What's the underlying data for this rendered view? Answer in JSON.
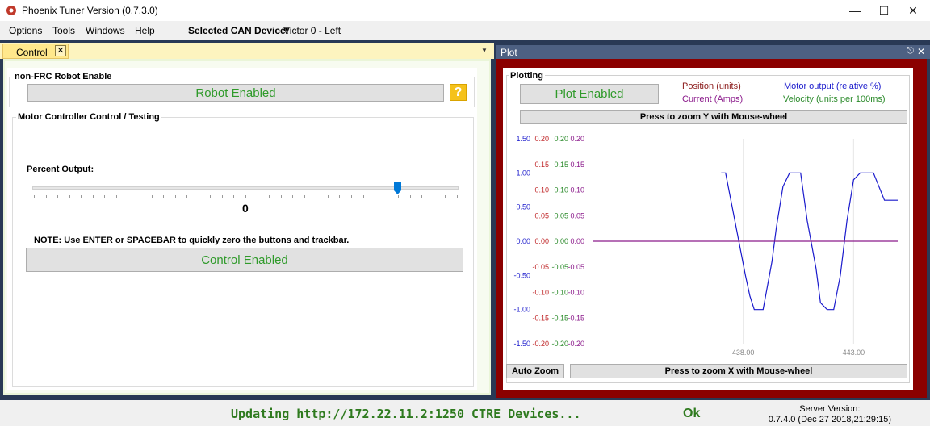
{
  "window": {
    "title": "Phoenix Tuner Version (0.7.3.0)",
    "minimize_icon": "minimize-icon",
    "maximize_icon": "maximize-icon",
    "close_icon": "close-icon"
  },
  "menu": {
    "items": [
      "Options",
      "Tools",
      "Windows",
      "Help"
    ],
    "can_label": "Selected CAN Device:",
    "can_value": "Victor 0 - Left"
  },
  "control_tab": {
    "label": "Control",
    "close": "✕"
  },
  "robot_group": {
    "title": "non-FRC Robot Enable",
    "button": "Robot Enabled",
    "help": "?"
  },
  "motor_group": {
    "title": "Motor Controller Control / Testing",
    "percent_label": "Percent Output:",
    "value": "0",
    "slider_level": 0.86,
    "note": "NOTE: Use ENTER or SPACEBAR to quickly zero the buttons and trackbar.",
    "control_button": "Control Enabled"
  },
  "plot_tab": {
    "label": "Plot",
    "pin": "📌",
    "close": "✕"
  },
  "plotting": {
    "title": "Plotting",
    "button": "Plot Enabled",
    "legend": {
      "position": "Position (units)",
      "motor": "Motor output (relative %)",
      "current": "Current (Amps)",
      "velocity": "Velocity (units per 100ms)"
    },
    "zoom_y": "Press to zoom Y with Mouse-wheel",
    "auto_zoom": "Auto Zoom",
    "zoom_x": "Press to zoom X with Mouse-wheel"
  },
  "colors": {
    "position": "#8b1a1a",
    "motor": "#1a1acc",
    "current": "#8b1a8b",
    "velocity": "#2a8a2a",
    "enabled_green": "#2f9a2a",
    "plot_frame": "#8b0000"
  },
  "chart_data": {
    "type": "line",
    "x_ticks": [
      "438.00",
      "443.00"
    ],
    "axes": [
      {
        "name": "motor",
        "color": "#1a1acc",
        "ticks": [
          "1.50",
          "1.00",
          "0.50",
          "0.00",
          "-0.50",
          "-1.00",
          "-1.50"
        ]
      },
      {
        "name": "position",
        "color": "#c0282a",
        "ticks": [
          "0.20",
          "0.15",
          "0.10",
          "0.05",
          "0.00",
          "-0.05",
          "-0.10",
          "-0.15",
          "-0.20"
        ]
      },
      {
        "name": "velocity",
        "color": "#2a8a2a",
        "ticks": [
          "0.20",
          "0.15",
          "0.10",
          "0.05",
          "0.00",
          "-0.05",
          "-0.10",
          "-0.15",
          "-0.20"
        ]
      },
      {
        "name": "current",
        "color": "#8b1a8b",
        "ticks": [
          "0.20",
          "0.15",
          "0.10",
          "0.05",
          "0.00",
          "-0.05",
          "-0.10",
          "-0.15",
          "-0.20"
        ]
      }
    ],
    "xlim": [
      436.0,
      445.0
    ],
    "ylim": [
      -1.5,
      1.5
    ],
    "series": [
      {
        "name": "Motor output (relative %)",
        "color": "#1a1acc",
        "x": [
          437.0,
          437.2,
          437.5,
          437.8,
          438.1,
          438.3,
          438.5,
          438.9,
          439.3,
          439.5,
          439.8,
          440.1,
          440.3,
          440.6,
          440.9,
          441.3,
          441.5,
          441.8,
          442.1,
          442.4,
          442.7,
          443.0,
          443.3,
          443.6,
          443.9,
          444.4,
          444.8,
          445.0
        ],
        "y": [
          1.0,
          1.0,
          0.5,
          0.0,
          -0.5,
          -0.8,
          -1.0,
          -1.0,
          -0.3,
          0.2,
          0.8,
          1.0,
          1.0,
          1.0,
          0.3,
          -0.4,
          -0.9,
          -1.0,
          -1.0,
          -0.5,
          0.3,
          0.9,
          1.0,
          1.0,
          1.0,
          0.6,
          0.6,
          0.6
        ]
      },
      {
        "name": "Position (units)",
        "color": "#8b1a8b",
        "x": [
          436.0,
          445.0
        ],
        "y": [
          0.0,
          0.0
        ]
      }
    ]
  },
  "status": {
    "text": "Updating http://172.22.11.2:1250 CTRE Devices...",
    "ok": "Ok",
    "server_label": "Server Version:",
    "server_version": "0.7.4.0 (Dec 27 2018,21:29:15)"
  }
}
